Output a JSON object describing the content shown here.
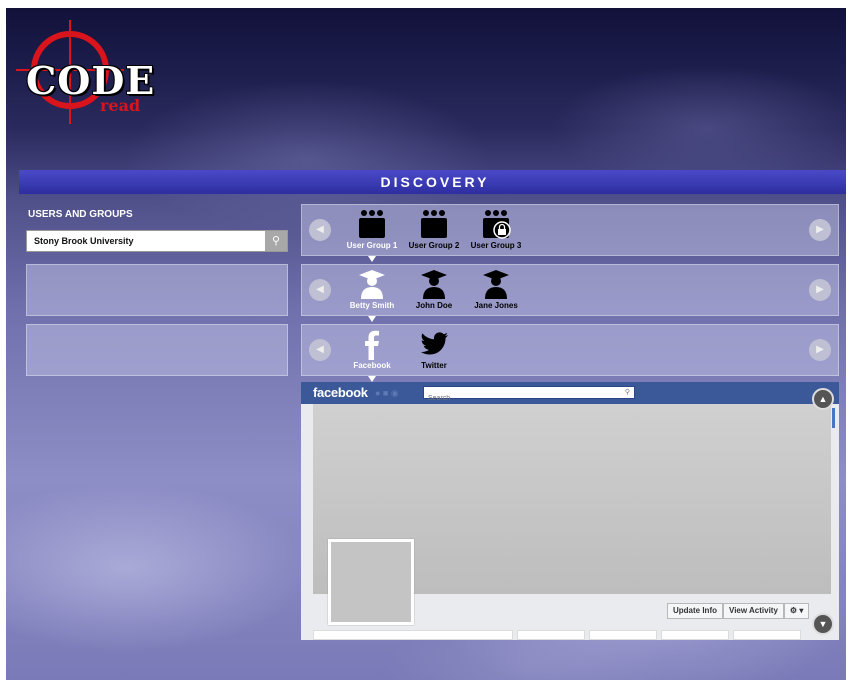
{
  "logo": {
    "word": "CODE",
    "sub": "read"
  },
  "header": {
    "title": "DISCOVERY"
  },
  "left": {
    "title": "USERS AND GROUPS",
    "search_value": "Stony Brook University",
    "search_icon": "search-icon"
  },
  "groups": {
    "items": [
      {
        "label": "User Group 1",
        "icon": "users-icon",
        "selected": true
      },
      {
        "label": "User Group 2",
        "icon": "users-icon",
        "selected": false
      },
      {
        "label": "User Group 3",
        "icon": "users-locked-icon",
        "selected": false
      }
    ]
  },
  "users": {
    "items": [
      {
        "label": "Betty Smith",
        "icon": "graduate-icon",
        "selected": true
      },
      {
        "label": "John Doe",
        "icon": "graduate-icon",
        "selected": false
      },
      {
        "label": "Jane Jones",
        "icon": "graduate-icon",
        "selected": false
      }
    ]
  },
  "networks": {
    "items": [
      {
        "label": "Facebook",
        "icon": "facebook-icon",
        "selected": true
      },
      {
        "label": "Twitter",
        "icon": "twitter-icon",
        "selected": false
      }
    ]
  },
  "facebook": {
    "logo": "facebook",
    "search_placeholder": "Search",
    "actions": {
      "update_info": "Update Info",
      "view_activity": "View Activity",
      "settings": "⚙ ▾"
    }
  },
  "colors": {
    "accent": "#3535b0",
    "brand_red": "#d9141c",
    "facebook": "#3b5998"
  }
}
